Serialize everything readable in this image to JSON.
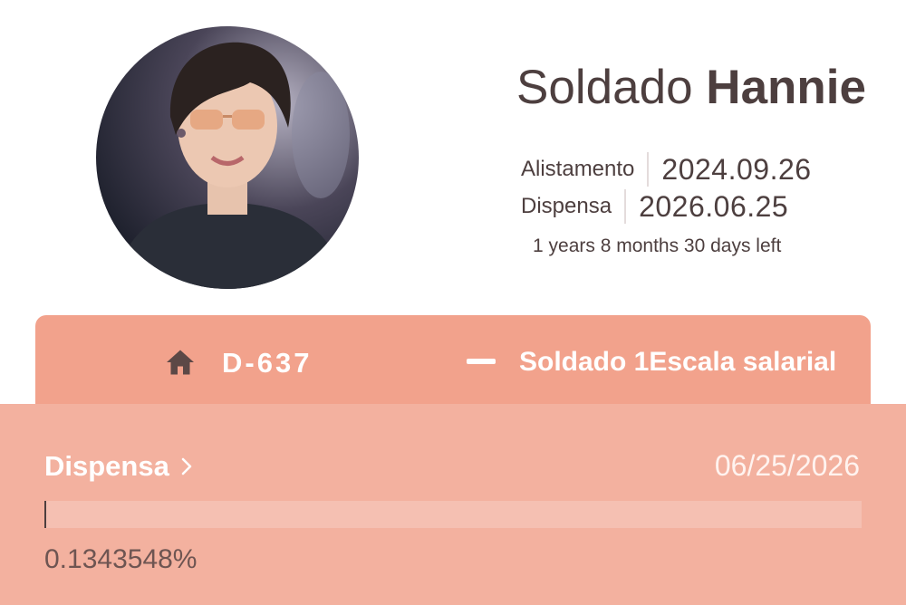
{
  "profile": {
    "rank_prefix": "Soldado",
    "name": "Hannie",
    "enlistment_label": "Alistamento",
    "enlistment_date": "2024.09.26",
    "discharge_label": "Dispensa",
    "discharge_date": "2026.06.25",
    "time_left": "1 years 8 months 30 days left"
  },
  "summary_bar": {
    "home_icon": "home-icon",
    "d_day": "D-637",
    "rank_icon": "private-rank-insignia-icon",
    "rank_text": "Soldado 1Escala salarial"
  },
  "discharge_card": {
    "label": "Dispensa",
    "chevron_icon": "chevron-right-icon",
    "date": "06/25/2026",
    "progress_percent": 0.1343548,
    "progress_text": "0.1343548%"
  },
  "colors": {
    "accent": "#f2a28c",
    "card_bg": "#f3b19f",
    "progress_track": "#f5c0b2",
    "text_dark": "#4d3f3f"
  }
}
